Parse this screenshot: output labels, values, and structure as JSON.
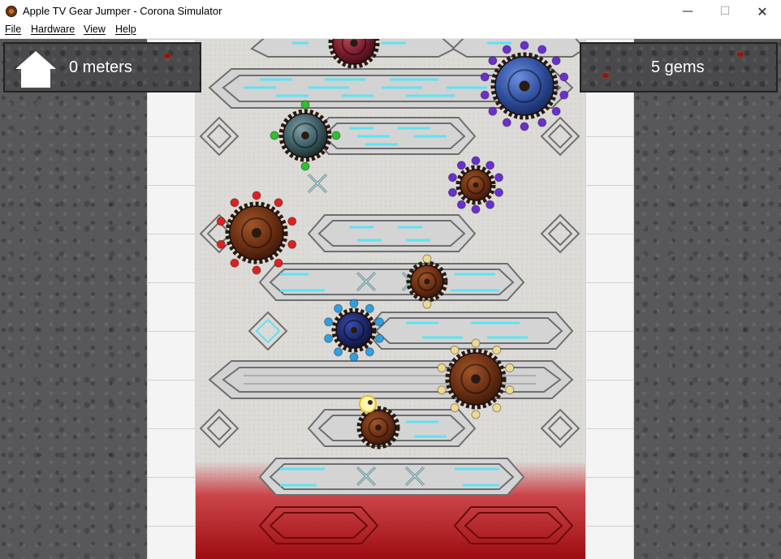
{
  "window": {
    "title": "Apple TV Gear Jumper - Corona Simulator",
    "controls": {
      "minimize": "—",
      "maximize": "☐",
      "close": "✕"
    }
  },
  "menu": {
    "items": [
      "File",
      "Hardware",
      "View",
      "Help"
    ]
  },
  "hud": {
    "distance": "0 meters",
    "gems": "5 gems",
    "home_icon": "home-icon"
  },
  "colors": {
    "track_glow": "#5ee3f2",
    "lava": "#c3141a",
    "gear_brown": "#7a3a1a",
    "gear_blue": "#3a5fb0",
    "gem_red": "#e02020",
    "gem_green": "#2fc02f",
    "gem_purple": "#6a2fd0",
    "gem_blue": "#2fa0e0",
    "gem_gold": "#f0d890"
  }
}
